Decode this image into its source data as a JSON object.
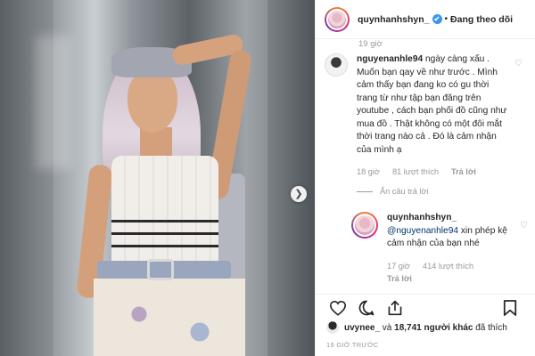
{
  "post": {
    "username": "quynhanhshyn_",
    "follow_status": "Đang theo dõi",
    "separator": "•",
    "verified_mark": "✔"
  },
  "thread": {
    "earlier_time": "19 giờ",
    "comment": {
      "user": "nguyenanhle94",
      "text": "ngày càng xấu . Muốn bạn qay về như trước . Mình cảm thấy bạn đang ko có gu thời trang từ như tập bạn đăng trên youtube , cách bạn phối đồ cũng như mua đồ . Thật không có một đôi mắt thời trang nào cả . Đó là cảm nhận của mình ạ",
      "time": "18 giờ",
      "likes": "81 lượt thích",
      "reply_label": "Trả lời"
    },
    "hide_replies": "Ẩn câu trả lời",
    "reply": {
      "user": "quynhanhshyn_",
      "mention": "@nguyenanhle94",
      "text": " xin phép kệ cảm nhận của bạn nhé",
      "time": "17 giờ",
      "likes": "414 lượt thích",
      "reply_label": "Trả lời"
    }
  },
  "likes_line": {
    "user": "uvynee_",
    "connector": " và ",
    "count": "18,741 người khác",
    "suffix": " đã thích"
  },
  "posted_time": "19 GIỜ TRƯỚC",
  "icons": {
    "next": "chevron-right-icon",
    "heart": "heart-icon",
    "comment": "comment-icon",
    "share": "share-icon",
    "bookmark": "bookmark-icon"
  }
}
